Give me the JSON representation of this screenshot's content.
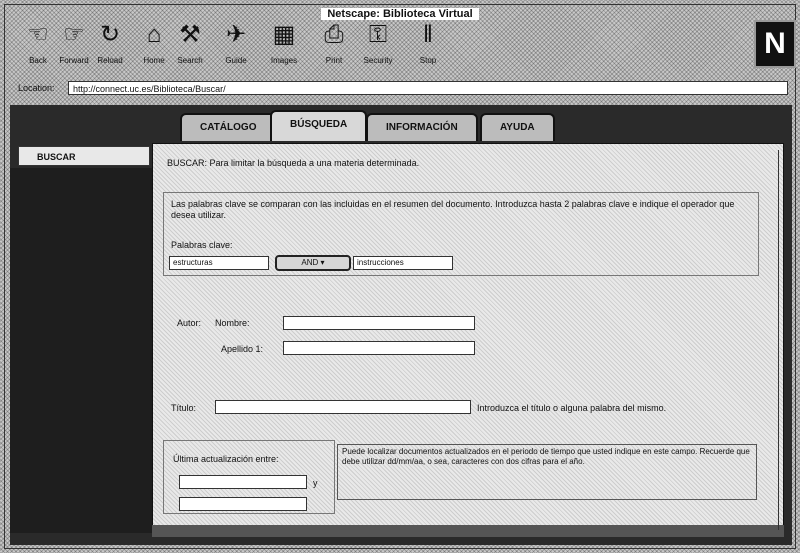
{
  "window": {
    "title": "Netscape: Biblioteca Virtual"
  },
  "toolbar": {
    "buttons": [
      {
        "label": "Back",
        "icon": "back-arrow-icon",
        "glyph": "☜"
      },
      {
        "label": "Forward",
        "icon": "forward-arrow-icon",
        "glyph": "☞"
      },
      {
        "label": "Reload",
        "icon": "reload-icon",
        "glyph": "↻"
      },
      {
        "label": "Home",
        "icon": "home-icon",
        "glyph": "⌂"
      },
      {
        "label": "Search",
        "icon": "search-icon",
        "glyph": "⚒"
      },
      {
        "label": "Guide",
        "icon": "guide-icon",
        "glyph": "✈"
      },
      {
        "label": "Images",
        "icon": "images-icon",
        "glyph": "▦"
      },
      {
        "label": "Print",
        "icon": "print-icon",
        "glyph": "⎙"
      },
      {
        "label": "Security",
        "icon": "security-lock-icon",
        "glyph": "⚿"
      },
      {
        "label": "Stop",
        "icon": "stop-icon",
        "glyph": "‖"
      }
    ],
    "logo": "N"
  },
  "location": {
    "label": "Location:",
    "url": "http://connect.uc.es/Biblioteca/Buscar/"
  },
  "tabs": [
    "CATÁLOGO",
    "BÚSQUEDA",
    "INFORMACIÓN",
    "AYUDA"
  ],
  "sidebar": {
    "active_item": "BUSCAR"
  },
  "form": {
    "intro": "BUSCAR: Para limitar la búsqueda a una materia determinada.",
    "description": "Las palabras clave se comparan con las incluidas en el resumen del documento. Introduzca hasta 2 palabras clave e indique el operador que desea utilizar.",
    "keywords_label": "Palabras clave:",
    "keyword1": "estructuras",
    "operator": "AND",
    "keyword2": "instrucciones",
    "author_label": "Autor:",
    "name_label": "Nombre:",
    "surname_label": "Apellido 1:",
    "title_label": "Título:",
    "title_hint": "Introduzca el título o alguna palabra del mismo.",
    "date_label": "Última actualización entre:",
    "date_sep": "y",
    "date_hint": "Puede localizar documentos actualizados en el periodo de tiempo que usted indique en este campo. Recuerde que debe utilizar dd/mm/aa, o sea, caracteres con dos cifras para el año."
  }
}
